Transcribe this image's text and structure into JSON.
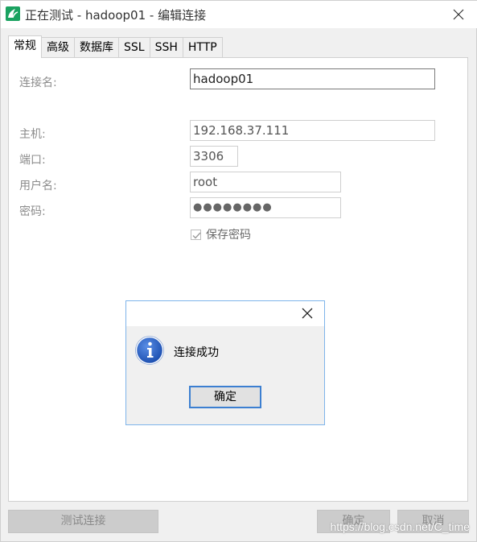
{
  "window": {
    "title": "正在测试 - hadoop01 - 编辑连接"
  },
  "tabs": [
    {
      "label": "常规",
      "active": true
    },
    {
      "label": "高级"
    },
    {
      "label": "数据库"
    },
    {
      "label": "SSL"
    },
    {
      "label": "SSH"
    },
    {
      "label": "HTTP"
    }
  ],
  "form": {
    "connection_name_label": "连接名:",
    "connection_name_value": "hadoop01",
    "host_label": "主机:",
    "host_value": "192.168.37.111",
    "port_label": "端口:",
    "port_value": "3306",
    "user_label": "用户名:",
    "user_value": "root",
    "password_label": "密码:",
    "password_mask": "●●●●●●●●",
    "save_password_label": "保存密码",
    "save_password_checked": true
  },
  "dialog": {
    "message": "连接成功",
    "ok_label": "确定"
  },
  "buttons": {
    "test_label": "测试连接",
    "ok_label": "确定",
    "cancel_label": "取消"
  },
  "watermark": "https://blog.csdn.net/C_time",
  "colors": {
    "accent": "#3c7fd1",
    "app_icon": "#1aa260",
    "info_icon": "#1c4fb0"
  }
}
